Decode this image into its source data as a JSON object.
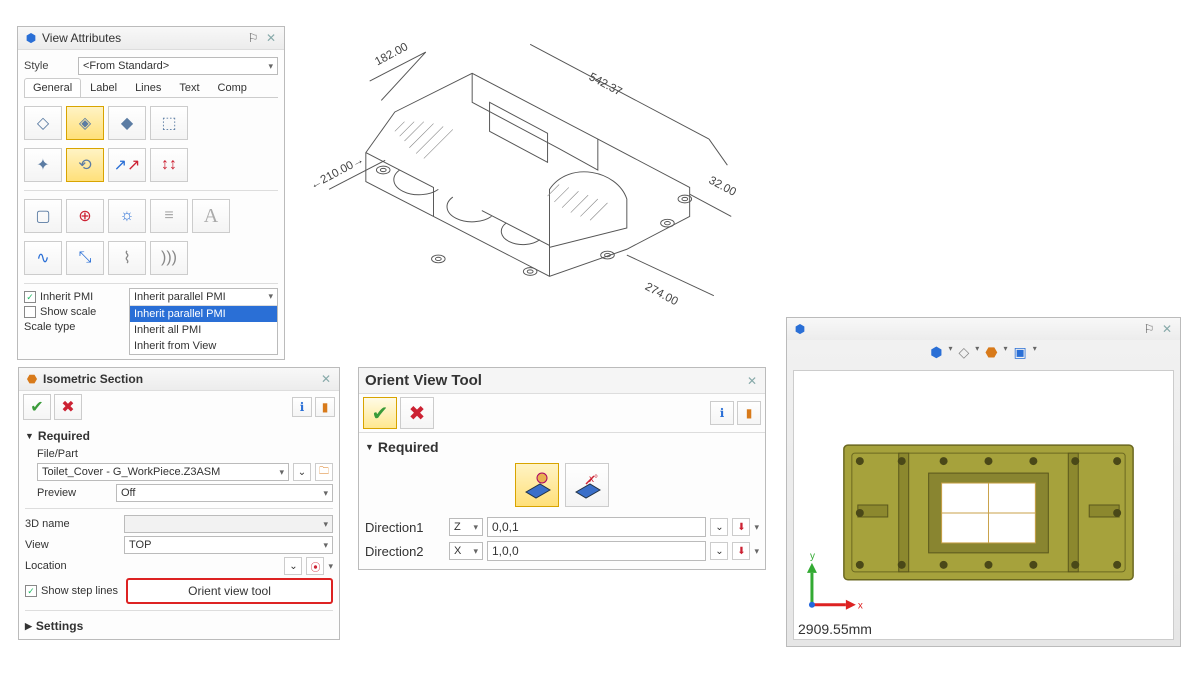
{
  "viewAttr": {
    "title": "View Attributes",
    "styleLabel": "Style",
    "styleValue": "<From Standard>",
    "tabs": [
      "General",
      "Label",
      "Lines",
      "Text",
      "Comp"
    ],
    "inheritPmiLabel": "Inherit PMI",
    "inheritPmiChecked": true,
    "showScaleLabel": "Show scale",
    "showScaleChecked": false,
    "scaleTypeLabel": "Scale type",
    "pmiOptions": [
      "Inherit parallel PMI",
      "Inherit parallel PMI",
      "Inherit all PMI",
      "Inherit from View"
    ],
    "pmiSelectedIndex": 1
  },
  "drawing": {
    "dims": {
      "d1": "182.00",
      "d2": "542.37",
      "d3": "32.00",
      "d4": "274.00",
      "d5": "210.00"
    }
  },
  "isoSection": {
    "title": "Isometric Section",
    "requiredLabel": "Required",
    "filePartLabel": "File/Part",
    "filePartValue": "Toilet_Cover - G_WorkPiece.Z3ASM",
    "previewLabel": "Preview",
    "previewValue": "Off",
    "name3dLabel": "3D name",
    "viewLabel": "View",
    "viewValue": "TOP",
    "locationLabel": "Location",
    "showStepLabel": "Show step lines",
    "showStepChecked": true,
    "orientBtn": "Orient view tool",
    "settingsLabel": "Settings"
  },
  "orient": {
    "title": "Orient View Tool",
    "requiredLabel": "Required",
    "dir1Label": "Direction1",
    "dir1Axis": "Z",
    "dir1Value": "0,0,1",
    "dir2Label": "Direction2",
    "dir2Axis": "X",
    "dir2Value": "1,0,0"
  },
  "viewport": {
    "readout": "2909.55mm",
    "axisX": "x",
    "axisY": "y"
  }
}
